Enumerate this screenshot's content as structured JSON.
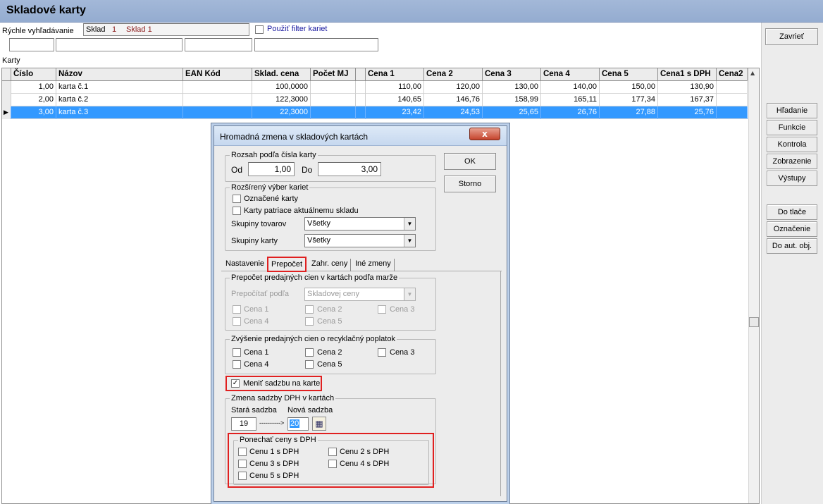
{
  "window": {
    "title": "Skladové karty"
  },
  "search": {
    "label": "Rýchle vyhľadávanie",
    "sklad_label": "Sklad",
    "sklad_num": "1",
    "sklad_name": "Sklad 1",
    "filter_label": "Použiť filter kariet"
  },
  "buttons": {
    "close": "Zavrieť",
    "side": [
      "Hľadanie",
      "Funkcie",
      "Kontrola",
      "Zobrazenie",
      "Výstupy"
    ],
    "side2": [
      "Do tlače",
      "Označenie",
      "Do aut. obj."
    ]
  },
  "grid": {
    "label": "Karty",
    "columns": [
      "Číslo",
      "Názov",
      "EAN Kód",
      "Sklad. cena",
      "Počet MJ",
      "Cena 1",
      "Cena 2",
      "Cena 3",
      "Cena 4",
      "Cena 5",
      "Cena1 s DPH",
      "Cena2"
    ],
    "rows": [
      [
        "1,00",
        "karta č.1",
        "",
        "100,0000",
        "",
        "110,00",
        "120,00",
        "130,00",
        "140,00",
        "150,00",
        "130,90",
        ""
      ],
      [
        "2,00",
        "karta č.2",
        "",
        "122,3000",
        "",
        "140,65",
        "146,76",
        "158,99",
        "165,11",
        "177,34",
        "167,37",
        ""
      ],
      [
        "3,00",
        "karta č.3",
        "",
        "22,3000",
        "",
        "23,42",
        "24,53",
        "25,65",
        "26,76",
        "27,88",
        "25,76",
        ""
      ]
    ],
    "selected_row": 2
  },
  "dialog": {
    "title": "Hromadná zmena v skladových kartách",
    "ok": "OK",
    "cancel": "Storno",
    "range": {
      "label": "Rozsah podľa čísla karty",
      "from_label": "Od",
      "from": "1,00",
      "to_label": "Do",
      "to": "3,00"
    },
    "ext": {
      "label": "Rozšírený výber kariet",
      "marked": "Označené karty",
      "current": "Karty patriace aktuálnemu skladu",
      "groups_label": "Skupiny tovarov",
      "groups_value": "Všetky",
      "card_groups_label": "Skupiny karty",
      "card_groups_value": "Všetky"
    },
    "tabs": [
      "Nastavenie",
      "Prepočet",
      "Zahr. ceny",
      "Iné zmeny"
    ],
    "active_tab": 1,
    "recalc": {
      "label": "Prepočet predajných cien v kartách podľa marže",
      "by_label": "Prepočítať podľa",
      "by_value": "Skladovej ceny",
      "prices": [
        "Cena 1",
        "Cena 2",
        "Cena 3",
        "Cena 4",
        "Cena 5"
      ]
    },
    "recycle": {
      "label": "Zvýšenie predajných cien o recyklačný poplatok",
      "prices": [
        "Cena 1",
        "Cena 2",
        "Cena 3",
        "Cena 4",
        "Cena 5"
      ]
    },
    "change_rate": {
      "label": "Meniť sadzbu na karte",
      "checked": true
    },
    "vat": {
      "label": "Zmena sadzby DPH v kartách",
      "old_label": "Stará sadzba",
      "new_label": "Nová sadzba",
      "old": "19",
      "arrow": "---------->",
      "new": "20"
    },
    "keep": {
      "label": "Ponechať ceny s DPH",
      "items": [
        "Cenu 1 s DPH",
        "Cenu 2 s DPH",
        "Cenu 3 s DPH",
        "Cenu 4 s DPH",
        "Cenu 5 s DPH"
      ]
    }
  }
}
